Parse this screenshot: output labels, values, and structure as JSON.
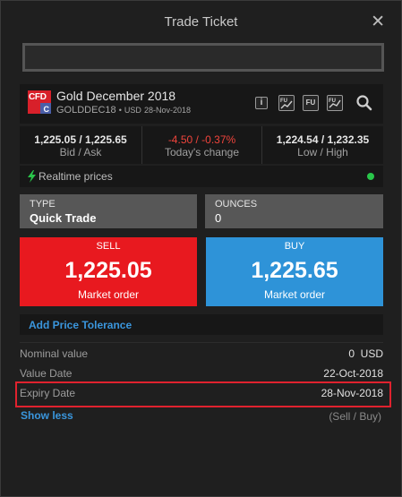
{
  "window": {
    "title": "Trade Ticket",
    "close_glyph": "✕"
  },
  "search": {
    "placeholder": "",
    "value": ""
  },
  "instrument": {
    "badge_text": "CFD",
    "badge_corner": "C",
    "name": "Gold December 2018",
    "symbol": "GOLDDEC18",
    "separator": "•",
    "currency": "USD",
    "expiry": "28-Nov-2018",
    "tools": {
      "info_glyph": "i",
      "fu_label": "FU",
      "icons": [
        "info-icon",
        "fu-chart-icon",
        "fu-icon",
        "fu-chart-alt-icon",
        "search-icon"
      ]
    }
  },
  "prices": {
    "bid_ask": "1,225.05 / 1,225.65",
    "bid_ask_label": "Bid / Ask",
    "change": "-4.50 / -0.37%",
    "change_label": "Today's change",
    "low_high": "1,224.54 / 1,232.35",
    "low_high_label": "Low / High"
  },
  "realtime": {
    "label": "Realtime prices",
    "status_color": "#29c64a"
  },
  "order_type": {
    "label": "TYPE",
    "value": "Quick Trade"
  },
  "amount": {
    "label": "OUNCES",
    "value": "0"
  },
  "sell": {
    "label": "SELL",
    "price": "1,225.05",
    "order": "Market order",
    "color": "#e8191f"
  },
  "buy": {
    "label": "BUY",
    "price": "1,225.65",
    "order": "Market order",
    "color": "#2e93d8"
  },
  "tolerance": {
    "label": "Add Price Tolerance"
  },
  "details": {
    "nominal_label": "Nominal value",
    "nominal_value": "0  USD",
    "value_date_label": "Value Date",
    "value_date": "22-Oct-2018",
    "expiry_label": "Expiry Date",
    "expiry_date": "28-Nov-2018"
  },
  "footer": {
    "show_less": "Show less",
    "sell_buy": "(Sell / Buy)"
  },
  "colors": {
    "accent_link": "#3a96dd",
    "negative": "#f0443c",
    "highlight_border": "#e0222e"
  }
}
